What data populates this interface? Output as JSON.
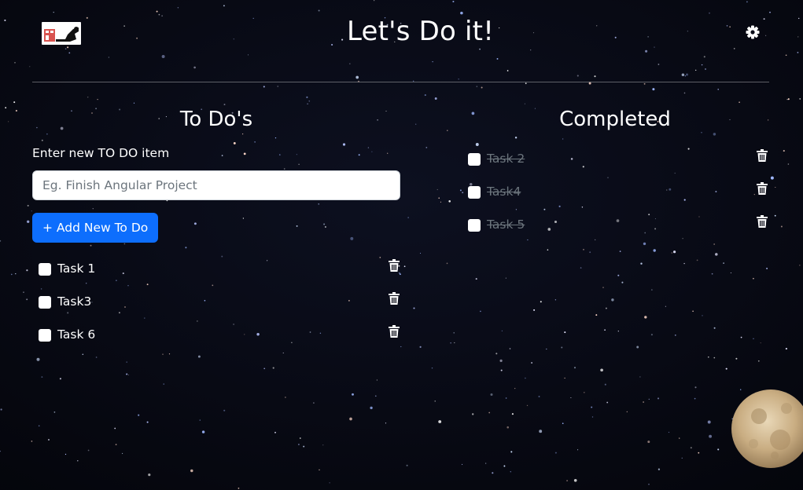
{
  "header": {
    "title": "Let's Do it!",
    "logo_icon": "flexed-arm-logo",
    "settings_icon": "gear-icon"
  },
  "todo": {
    "heading": "To Do's",
    "input_label": "Enter new TO DO item",
    "input_placeholder": "Eg. Finish Angular Project",
    "input_value": "",
    "add_button_label": "+ Add New To Do",
    "items": [
      {
        "label": "Task 1",
        "checked": false
      },
      {
        "label": "Task3",
        "checked": false
      },
      {
        "label": "Task 6",
        "checked": false
      }
    ]
  },
  "completed": {
    "heading": "Completed",
    "items": [
      {
        "label": "Task 2",
        "checked": false
      },
      {
        "label": "Task4",
        "checked": false
      },
      {
        "label": "Task 5",
        "checked": false
      }
    ]
  },
  "colors": {
    "primary_button": "#0d6efd",
    "completed_text": "#6c757d",
    "background": "#06070f"
  }
}
